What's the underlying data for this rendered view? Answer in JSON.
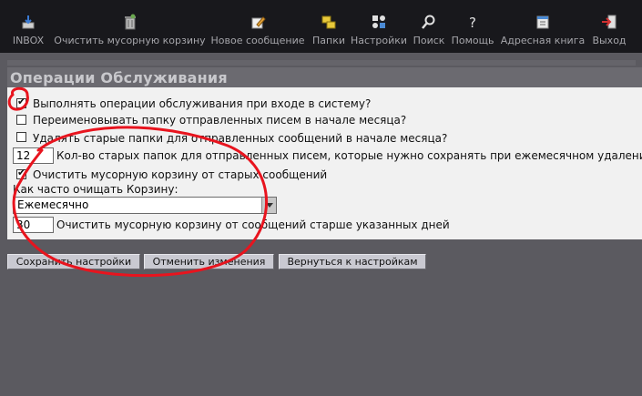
{
  "toolbar": {
    "items": [
      {
        "label": "INBOX",
        "icon": "inbox-icon"
      },
      {
        "label": "Очистить мусорную корзину",
        "icon": "trash-icon"
      },
      {
        "label": "Новое сообщение",
        "icon": "compose-icon"
      },
      {
        "label": "Папки",
        "icon": "folders-icon"
      },
      {
        "label": "Настройки",
        "icon": "settings-icon"
      },
      {
        "label": "Поиск",
        "icon": "search-icon"
      },
      {
        "label": "Помощь",
        "icon": "help-icon"
      },
      {
        "label": "Адресная книга",
        "icon": "address-book-icon"
      },
      {
        "label": "Выход",
        "icon": "logout-icon"
      }
    ]
  },
  "page": {
    "title": "Операции Обслуживания"
  },
  "options": {
    "run_on_login": {
      "label": "Выполнять операции обслуживания при входе в систему?",
      "checked": true
    },
    "rename_sent": {
      "label": "Переименовывать папку отправленных писем в начале месяца?",
      "checked": false
    },
    "delete_old_sent": {
      "label": "Удалять старые папки для отправленных сообщений в начале месяца?",
      "checked": false
    },
    "keep_count": {
      "value": "12",
      "label": "Кол-во старых папок для отправленных писем, которые нужно сохранять при ежемесячном удалении"
    },
    "purge_trash": {
      "label": "Очистить мусорную корзину от старых сообщений",
      "checked": true
    },
    "frequency": {
      "label": "Как часто очищать Корзину:",
      "selected": "Ежемесячно"
    },
    "older_than": {
      "value": "30",
      "label": "Очистить мусорную корзину от сообщений старше указанных дней"
    }
  },
  "buttons": {
    "save": "Сохранить настройки",
    "cancel": "Отменить изменения",
    "back": "Вернуться к настройкам"
  },
  "colors": {
    "annotation": "#e8141e",
    "toolbar_bg": "#18181c",
    "page_bg": "#5b5a60"
  }
}
